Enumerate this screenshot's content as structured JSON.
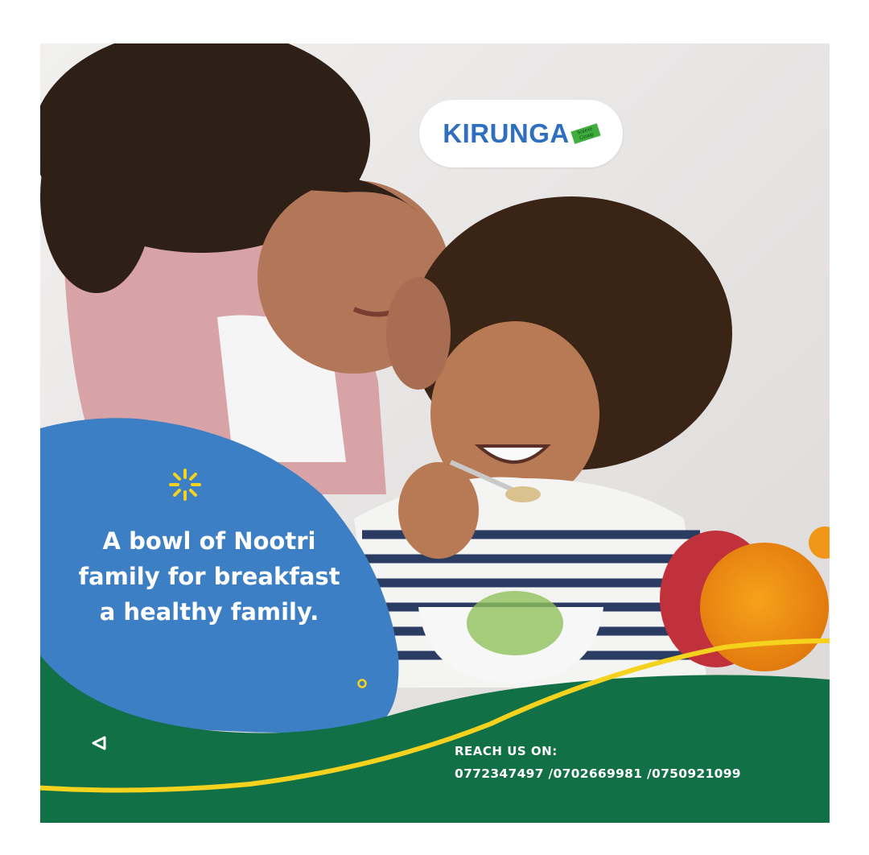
{
  "brand": {
    "logo_text": "KIRUNGA",
    "logo_tag": "Sorexe Group"
  },
  "headline": {
    "lines": [
      "A bowl of Nootri",
      "family for breakfast",
      "a healthy family."
    ]
  },
  "contact": {
    "title": "REACH US ON:",
    "phones": "0772347497 /0702669981 /0750921099"
  },
  "colors": {
    "blue": "#3d7fc4",
    "green": "#127046",
    "yellow": "#f4d21d",
    "logo_blue": "#2f6fc0"
  },
  "icons": [
    "sparkle-icon",
    "ring-icon",
    "triangle-play-icon"
  ]
}
